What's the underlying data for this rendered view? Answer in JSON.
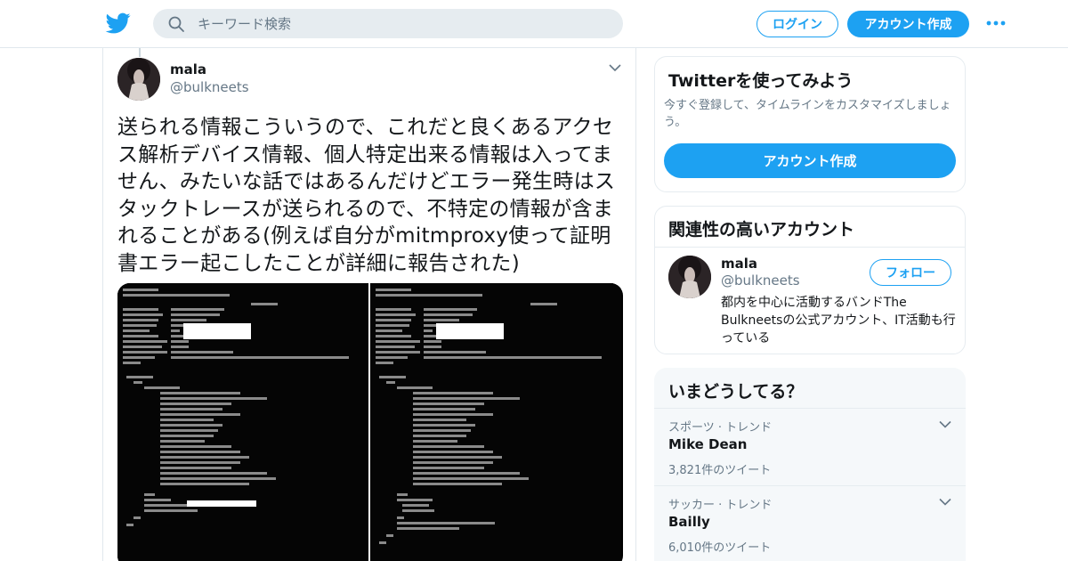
{
  "header": {
    "search_placeholder": "キーワード検索",
    "login_label": "ログイン",
    "signup_label": "アカウント作成",
    "icons": {
      "logo": "twitter-bird-icon",
      "search": "search-icon",
      "more": "more-dots-icon"
    }
  },
  "tweet": {
    "author_name": "mala",
    "author_handle": "@bulkneets",
    "text": "送られる情報こういうので、これだと良くあるアクセス解析デバイス情報、個人特定出来る情報は入ってません、みたいな話ではあるんだけどエラー発生時はスタックトレースが送られるので、不特定の情報が含まれることがある(例えば自分がmitmproxy使って証明書エラー起こしたことが詳細に報告された)"
  },
  "sidebar": {
    "try_card": {
      "title": "Twitterを使ってみよう",
      "description": "今すぐ登録して、タイムラインをカスタマイズしましょう。",
      "button_label": "アカウント作成"
    },
    "related_card": {
      "title": "関連性の高いアカウント",
      "account": {
        "name": "mala",
        "handle": "@bulkneets",
        "follow_label": "フォロー",
        "bio": "都内を中心に活動するバンドThe Bulkneetsの公式アカウント、IT活動も行っている"
      }
    },
    "trends_card": {
      "title": "いまどうしてる？",
      "items": [
        {
          "category": "スポーツ · トレンド",
          "name": "Mike Dean",
          "count": "3,821件のツイート"
        },
        {
          "category": "サッカー · トレンド",
          "name": "Bailly",
          "count": "6,010件のツイート"
        }
      ]
    }
  },
  "colors": {
    "accent": "#1da1f2",
    "text": "#14171a",
    "muted": "#657786",
    "border": "#e6ecf0"
  }
}
